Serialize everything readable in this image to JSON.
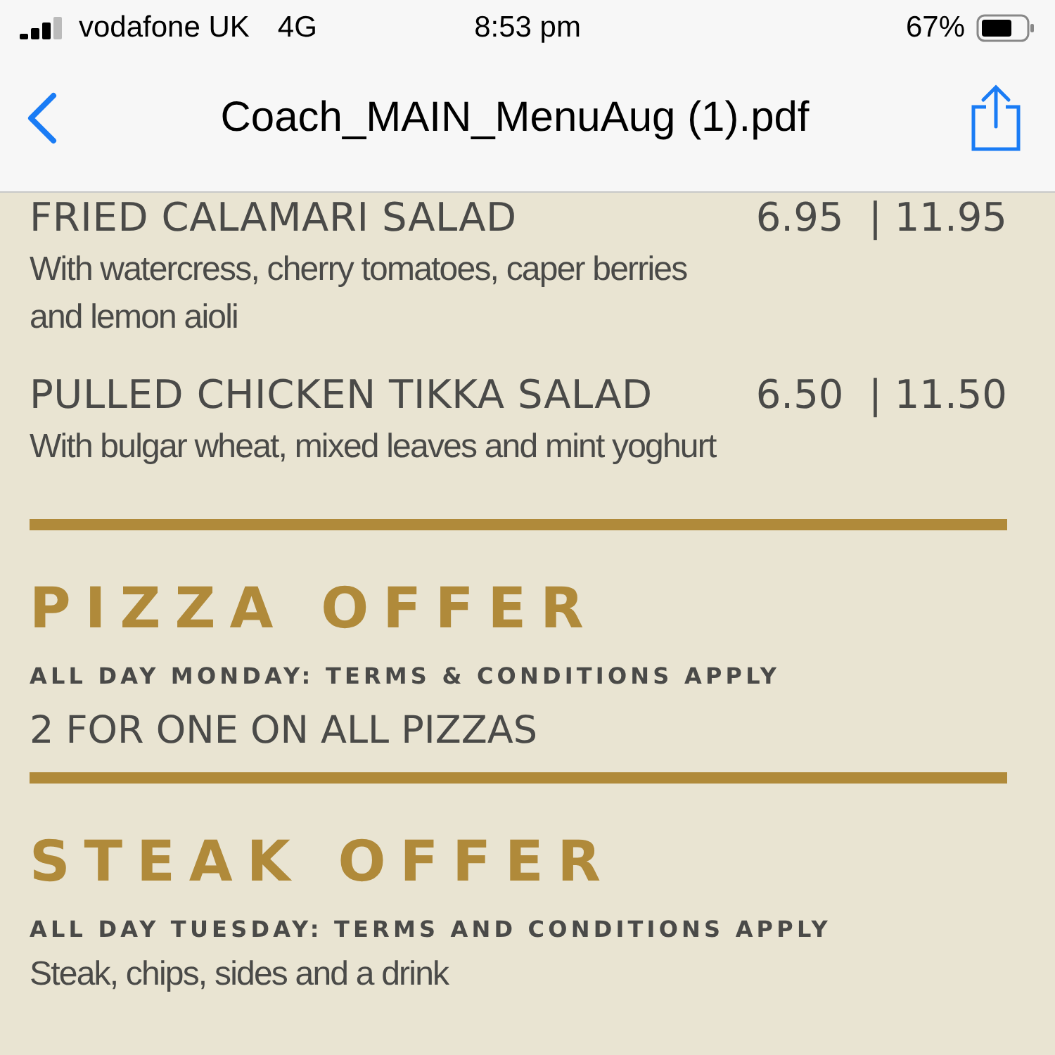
{
  "status_bar": {
    "carrier": "vodafone UK",
    "network": "4G",
    "time": "8:53 pm",
    "battery": "67%"
  },
  "nav": {
    "title": "Coach_MAIN_MenuAug (1).pdf"
  },
  "menu_items": [
    {
      "name": "FRIED CALAMARI SALAD",
      "price": "6.95  | 11.95",
      "description": "With watercress, cherry tomatoes, caper berries and lemon aioli"
    },
    {
      "name": "PULLED CHICKEN TIKKA SALAD",
      "price": "6.50  | 11.50",
      "description": "With bulgar wheat, mixed leaves and mint yoghurt"
    }
  ],
  "offers": [
    {
      "title": "PIZZA OFFER",
      "terms": "ALL DAY MONDAY: TERMS & CONDITIONS APPLY",
      "detail": {
        "kind": "headline",
        "text": "2 FOR ONE ON ALL PIZZAS"
      }
    },
    {
      "title": "STEAK OFFER",
      "terms": "ALL DAY TUESDAY: TERMS AND CONDITIONS APPLY",
      "detail": {
        "kind": "description",
        "text": "Steak, chips, sides and a drink"
      }
    }
  ]
}
